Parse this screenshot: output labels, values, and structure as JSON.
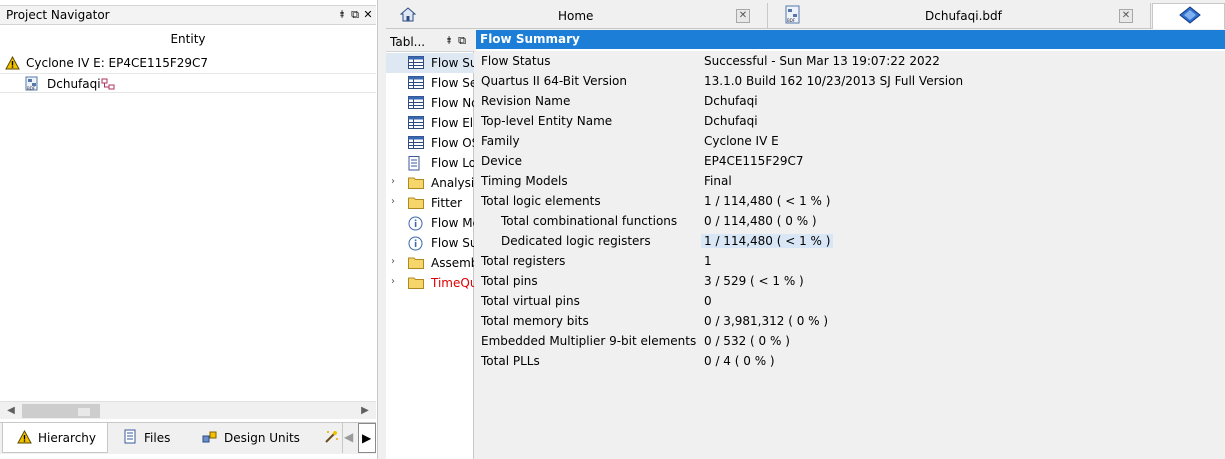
{
  "navigator": {
    "title": "Project Navigator",
    "pin_glyph": "⯒",
    "float_glyph": "⧉",
    "close_glyph": "✕",
    "column_header": "Entity",
    "device_label": "Cyclone IV E: EP4CE115F29C7",
    "entity_label": "Dchufaqi",
    "scroll_left": "◀",
    "scroll_right": "▶",
    "tabs": [
      {
        "label": "Hierarchy",
        "icon": "warning-triangle-icon"
      },
      {
        "label": "Files",
        "icon": "document-icon"
      },
      {
        "label": "Design Units",
        "icon": "design-units-icon"
      }
    ],
    "more_arrow": "▶"
  },
  "top_tabs": [
    {
      "label": "Home",
      "icon": "home-icon"
    },
    {
      "label": "Dchufaqi.bdf",
      "icon": "bdf-file-icon"
    }
  ],
  "tab_close_glyph": "✕",
  "toc": {
    "title": "Tabl...",
    "expand_glyph": "›",
    "items": [
      {
        "label": "Flow Summary",
        "icon": "table-icon",
        "expandable": false,
        "color": "#000000"
      },
      {
        "label": "Flow Settings",
        "icon": "table-icon",
        "expandable": false,
        "color": "#000000"
      },
      {
        "label": "Flow Non-Default Global Settings",
        "icon": "table-icon",
        "expandable": false,
        "color": "#000000"
      },
      {
        "label": "Flow Elapsed Time",
        "icon": "table-icon",
        "expandable": false,
        "color": "#000000"
      },
      {
        "label": "Flow OS Summary",
        "icon": "table-icon",
        "expandable": false,
        "color": "#000000"
      },
      {
        "label": "Flow Log",
        "icon": "document-icon",
        "expandable": false,
        "color": "#000000"
      },
      {
        "label": "Analysis & Synthesis",
        "icon": "folder-icon",
        "expandable": true,
        "color": "#000000"
      },
      {
        "label": "Fitter",
        "icon": "folder-icon",
        "expandable": true,
        "color": "#000000"
      },
      {
        "label": "Flow Messages",
        "icon": "info-icon",
        "expandable": false,
        "color": "#000000"
      },
      {
        "label": "Flow Suppressed Messages",
        "icon": "info-icon",
        "expandable": false,
        "color": "#000000"
      },
      {
        "label": "Assembler",
        "icon": "folder-icon",
        "expandable": true,
        "color": "#000000"
      },
      {
        "label": "TimeQuest Timing Analyzer",
        "icon": "folder-icon",
        "expandable": true,
        "color": "#e00000"
      }
    ]
  },
  "summary": {
    "title": "Flow Summary",
    "rows": [
      {
        "key": "Flow Status",
        "value": "Successful - Sun Mar 13 19:07:22 2022",
        "indent": false,
        "highlight": false
      },
      {
        "key": "Quartus II 64-Bit Version",
        "value": "13.1.0 Build 162 10/23/2013 SJ Full Version",
        "indent": false,
        "highlight": false
      },
      {
        "key": "Revision Name",
        "value": "Dchufaqi",
        "indent": false,
        "highlight": false
      },
      {
        "key": "Top-level Entity Name",
        "value": "Dchufaqi",
        "indent": false,
        "highlight": false
      },
      {
        "key": "Family",
        "value": "Cyclone IV E",
        "indent": false,
        "highlight": false
      },
      {
        "key": "Device",
        "value": "EP4CE115F29C7",
        "indent": false,
        "highlight": false
      },
      {
        "key": "Timing Models",
        "value": "Final",
        "indent": false,
        "highlight": false
      },
      {
        "key": "Total logic elements",
        "value": "1 / 114,480 ( < 1 % )",
        "indent": false,
        "highlight": false
      },
      {
        "key": "Total combinational functions",
        "value": "0 / 114,480 ( 0 % )",
        "indent": true,
        "highlight": false
      },
      {
        "key": "Dedicated logic registers",
        "value": "1 / 114,480 ( < 1 % )",
        "indent": true,
        "highlight": true
      },
      {
        "key": "Total registers",
        "value": "1",
        "indent": false,
        "highlight": false
      },
      {
        "key": "Total pins",
        "value": "3 / 529 ( < 1 % )",
        "indent": false,
        "highlight": false
      },
      {
        "key": "Total virtual pins",
        "value": "0",
        "indent": false,
        "highlight": false
      },
      {
        "key": "Total memory bits",
        "value": "0 / 3,981,312 ( 0 % )",
        "indent": false,
        "highlight": false
      },
      {
        "key": "Embedded Multiplier 9-bit elements",
        "value": "0 / 532 ( 0 % )",
        "indent": false,
        "highlight": false
      },
      {
        "key": "Total PLLs",
        "value": "0 / 4 ( 0 % )",
        "indent": false,
        "highlight": false
      }
    ]
  },
  "colors": {
    "accent": "#1c7ed6",
    "warning": "#f2c200",
    "folder": "#f6d66a",
    "highlight": "#d8e6f5",
    "error_text": "#e00000"
  }
}
